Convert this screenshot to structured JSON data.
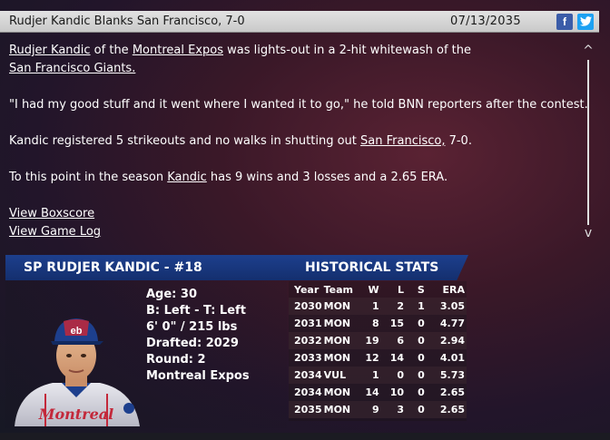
{
  "header": {
    "headline": "Rudjer Kandic Blanks San Francisco, 7-0",
    "date": "07/13/2035",
    "facebook_icon": "f",
    "twitter_icon": "twitter-bird"
  },
  "article": {
    "p1": {
      "player": "Rudjer Kandic",
      "t1": " of the ",
      "team": "Montreal Expos",
      "t2": " was lights-out in a 2-hit whitewash of the ",
      "opponent": "San Francisco Giants."
    },
    "p2": "\"I had my good stuff and it went where I wanted it to go,\" he told BNN reporters after the contest.",
    "p3": {
      "t1": "Kandic registered 5 strikeouts and no walks in shutting out ",
      "opponent": "San Francisco,",
      "t2": " 7-0."
    },
    "p4": {
      "t1": "To this point in the season ",
      "player": "Kandic",
      "t2": " has 9 wins and 3 losses and a 2.65 ERA."
    },
    "links": {
      "boxscore": "View Boxscore",
      "game_log": "View Game Log"
    }
  },
  "scroll": {
    "up": "^",
    "down": "v"
  },
  "player_card": {
    "banner_left": "SP RUDJER KANDIC - #18",
    "banner_right": "HISTORICAL STATS",
    "bio": {
      "age": "Age: 30",
      "bats_throws": "B: Left - T: Left",
      "height_weight": "6' 0\" / 215 lbs",
      "drafted": "Drafted: 2029",
      "round": "Round: 2",
      "team": "Montreal Expos"
    }
  },
  "stats": {
    "headers": [
      "Year",
      "Team",
      "W",
      "L",
      "S",
      "ERA"
    ],
    "rows": [
      [
        "2030",
        "MON",
        "1",
        "2",
        "1",
        "3.05"
      ],
      [
        "2031",
        "MON",
        "8",
        "15",
        "0",
        "4.77"
      ],
      [
        "2032",
        "MON",
        "19",
        "6",
        "0",
        "2.94"
      ],
      [
        "2033",
        "MON",
        "12",
        "14",
        "0",
        "4.01"
      ],
      [
        "2034",
        "VUL",
        "1",
        "0",
        "0",
        "5.73"
      ],
      [
        "2034",
        "MON",
        "14",
        "10",
        "0",
        "2.65"
      ],
      [
        "2035",
        "MON",
        "9",
        "3",
        "0",
        "2.65"
      ]
    ]
  },
  "colors": {
    "banner": "#1d3f8d",
    "facebook": "#3b5ca8",
    "twitter": "#1da1f2",
    "background": "#3a1828"
  }
}
